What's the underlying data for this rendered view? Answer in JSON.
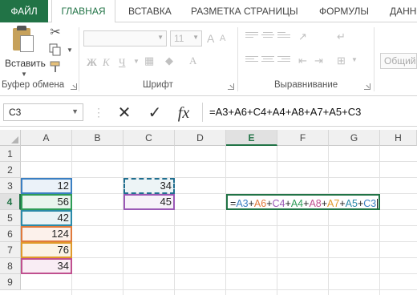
{
  "ribbon": {
    "tabs": [
      {
        "label": "ФАЙЛ"
      },
      {
        "label": "ГЛАВНАЯ"
      },
      {
        "label": "ВСТАВКА"
      },
      {
        "label": "РАЗМЕТКА СТРАНИЦЫ"
      },
      {
        "label": "ФОРМУЛЫ"
      },
      {
        "label": "ДАНН"
      }
    ],
    "active_tab": "ГЛАВНАЯ",
    "paste_label": "Вставить",
    "font_size": "11",
    "font_size_up": "A",
    "font_size_down": "A",
    "bold": "Ж",
    "italic": "К",
    "underline": "Ч",
    "style_box": "Общий",
    "groups": {
      "clipboard": "Буфер обмена",
      "font": "Шрифт",
      "alignment": "Выравнивание"
    }
  },
  "formula_bar": {
    "name_box": "C3",
    "cancel_icon": "✕",
    "enter_icon": "✓",
    "fx_label": "fx",
    "formula": "=A3+A6+C4+A4+A8+A7+A5+C3"
  },
  "grid": {
    "columns": [
      "A",
      "B",
      "C",
      "D",
      "E",
      "F",
      "G",
      "H"
    ],
    "active_column": "E",
    "rows": [
      "1",
      "2",
      "3",
      "4",
      "5",
      "6",
      "7",
      "8",
      "9"
    ],
    "active_row": "4",
    "cells": {
      "A3": "12",
      "A4": "56",
      "A5": "42",
      "A6": "124",
      "A7": "76",
      "A8": "34",
      "C3": "34",
      "C4": "45"
    },
    "edit_formula_parts": [
      {
        "text": "=",
        "color": "#222222"
      },
      {
        "text": "A3",
        "color": "#3a7fc2"
      },
      {
        "text": "+",
        "color": "#222222"
      },
      {
        "text": "A6",
        "color": "#e07a3c"
      },
      {
        "text": "+",
        "color": "#222222"
      },
      {
        "text": "C4",
        "color": "#9b59b6"
      },
      {
        "text": "+",
        "color": "#222222"
      },
      {
        "text": "A4",
        "color": "#2e9c57"
      },
      {
        "text": "+",
        "color": "#222222"
      },
      {
        "text": "A8",
        "color": "#c0508f"
      },
      {
        "text": "+",
        "color": "#222222"
      },
      {
        "text": "A7",
        "color": "#e09a2a"
      },
      {
        "text": "+",
        "color": "#222222"
      },
      {
        "text": "A5",
        "color": "#2a8aa8"
      },
      {
        "text": "+",
        "color": "#222222"
      },
      {
        "text": "C3",
        "color": "#3a7fc2"
      }
    ]
  },
  "colors": {
    "accent": "#217346",
    "ref_a3": "#3a7fc2",
    "ref_a4": "#2e9c57",
    "ref_a5": "#2a8aa8",
    "ref_a6": "#e07a3c",
    "ref_a7": "#e09a2a",
    "ref_a8": "#c0508f",
    "ref_c3": "#1f6e8f",
    "ref_c4": "#9b59b6"
  }
}
